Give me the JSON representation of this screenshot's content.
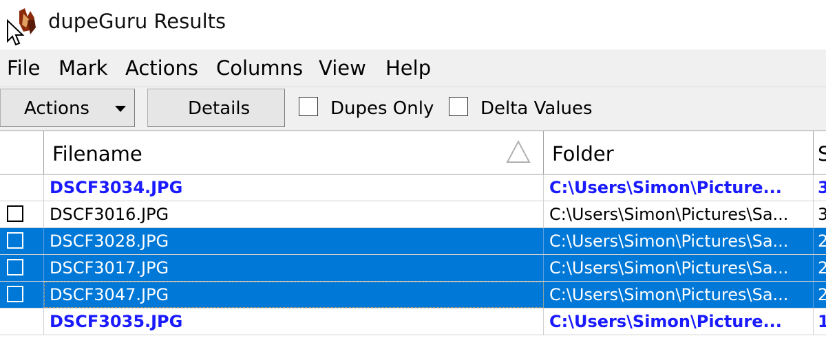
{
  "window": {
    "title": "dupeGuru Results"
  },
  "menu": [
    "File",
    "Mark",
    "Actions",
    "Columns",
    "View",
    "Help"
  ],
  "toolbar": {
    "actions_label": "Actions",
    "details_label": "Details",
    "dupes_only_label": "Dupes Only",
    "delta_values_label": "Delta Values"
  },
  "columns": {
    "filename": "Filename",
    "folder": "Folder",
    "size_partial": "S"
  },
  "rows": [
    {
      "filename": "DSCF3034.JPG",
      "folder": "C:\\Users\\Simon\\Picture...",
      "size": "3",
      "reference": true,
      "selected": false,
      "checkbox": false
    },
    {
      "filename": "DSCF3016.JPG",
      "folder": "C:\\Users\\Simon\\Pictures\\Sa...",
      "size": "3",
      "reference": false,
      "selected": false,
      "checkbox": true
    },
    {
      "filename": "DSCF3028.JPG",
      "folder": "C:\\Users\\Simon\\Pictures\\Sa...",
      "size": "2",
      "reference": false,
      "selected": true,
      "checkbox": true
    },
    {
      "filename": "DSCF3017.JPG",
      "folder": "C:\\Users\\Simon\\Pictures\\Sa...",
      "size": "2",
      "reference": false,
      "selected": true,
      "checkbox": true
    },
    {
      "filename": "DSCF3047.JPG",
      "folder": "C:\\Users\\Simon\\Pictures\\Sa...",
      "size": "2",
      "reference": false,
      "selected": true,
      "checkbox": true
    },
    {
      "filename": "DSCF3035.JPG",
      "folder": "C:\\Users\\Simon\\Picture...",
      "size": "1",
      "reference": true,
      "selected": false,
      "checkbox": false
    }
  ],
  "colors": {
    "selection": "#0078d7",
    "reference_text": "#1a1aff"
  }
}
